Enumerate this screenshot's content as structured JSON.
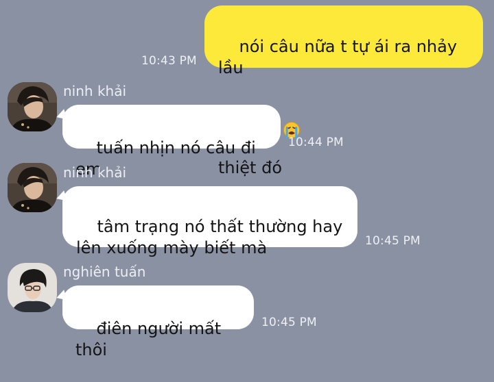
{
  "messages": [
    {
      "direction": "outgoing",
      "text": "nói câu nữa t tự ái ra nhảy lầu\nthiệt đó",
      "emoji": "loudly-crying-face",
      "time": "10:43 PM"
    },
    {
      "direction": "incoming",
      "sender": "ninh khải",
      "text": "tuấn nhịn nó câu đi em",
      "time": "10:44 PM"
    },
    {
      "direction": "incoming",
      "sender": "ninh khải",
      "text": "tâm trạng nó thất thường hay\nlên xuống mày biết mà",
      "time": "10:45 PM"
    },
    {
      "direction": "incoming",
      "sender": "nghiên tuấn",
      "text": "điên người mất thôi",
      "time": "10:45 PM"
    }
  ],
  "colors": {
    "background": "#8a91a3",
    "outgoing_bubble": "#fde93a",
    "incoming_bubble": "#ffffff"
  }
}
